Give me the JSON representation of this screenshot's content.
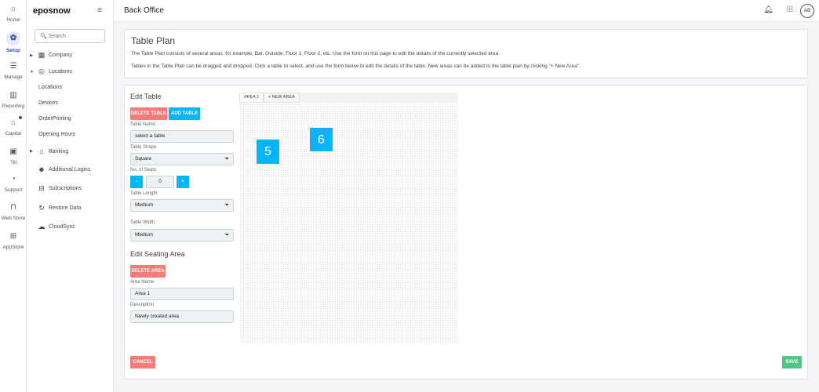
{
  "rail": [
    {
      "label": "Home",
      "icon": "home-icon",
      "g": "⌂"
    },
    {
      "label": "Setup",
      "icon": "gear-icon",
      "g": "✿",
      "active": true
    },
    {
      "label": "Manage",
      "icon": "checklist-icon",
      "g": "☰"
    },
    {
      "label": "Reporting",
      "icon": "bar-chart-icon",
      "g": "▥"
    },
    {
      "label": "Capital",
      "icon": "bank-icon",
      "g": "⌂"
    },
    {
      "label": "Till",
      "icon": "monitor-icon",
      "g": "▣"
    },
    {
      "label": "Support",
      "icon": "headset-icon",
      "g": "◔"
    },
    {
      "label": "Web Store",
      "icon": "bag-icon",
      "g": "⊓"
    },
    {
      "label": "AppStore",
      "icon": "apps-icon",
      "g": "⊞"
    }
  ],
  "sidebar": {
    "logo": "eposnow",
    "search_placeholder": "Search",
    "company": "Company",
    "locations": "Locations",
    "sub": [
      "Locations",
      "Devices",
      "OrderPrinting",
      "Opening Hours"
    ],
    "banking": "Banking",
    "additional": "Additional Logins",
    "subscriptions": "Subscriptions",
    "restore": "Restore Data",
    "cloudsync": "CloudSync"
  },
  "header": {
    "title": "Back Office",
    "avatar": "AB"
  },
  "info": {
    "title": "Table Plan",
    "p1": "The Table Plan consists of several areas, for example, Bar, Outside, Floor 1, Floor 2, etc. Use the form on this page to edit the details of the currently selected area.",
    "p2": "Tables in the Table Plan can be dragged and dropped. Click a table to select, and use the form below to edit the details of the table. New areas can be added to the table plan by clicking \"+ New Area\"."
  },
  "form": {
    "edit_table": "Edit Table",
    "delete_table": "DELETE TABLE",
    "add_table": "ADD TABLE",
    "table_name_label": "Table Name:",
    "table_name": "select a table",
    "shape_label": "Table Shape",
    "shape": "Square",
    "seats_label": "No. of Seats:",
    "seats": "0",
    "minus": "-",
    "plus": "+",
    "length_label": "Table Length:",
    "length": "Medium",
    "width_label": "Table Width:",
    "width": "Medium",
    "edit_area": "Edit Seating Area",
    "delete_area": "DELETE AREA",
    "area_name_label": "Area Name",
    "area_name": "Area 1",
    "desc_label": "Description",
    "desc": "Newly created area",
    "cancel": "CANCEL",
    "save": "SAVE"
  },
  "plan": {
    "tabs": [
      "AREA 1",
      "+ NEW AREA"
    ],
    "tables": [
      "5",
      "6"
    ]
  }
}
